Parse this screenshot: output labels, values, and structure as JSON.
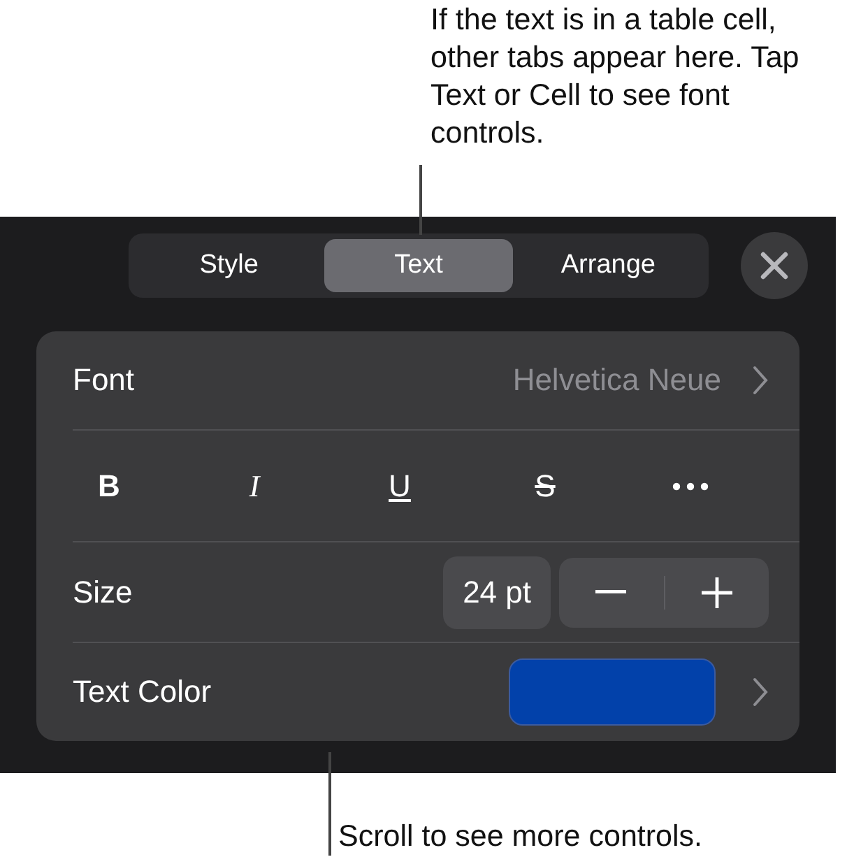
{
  "callout_top": "If the text is in a table cell, other tabs appear here. Tap Text or Cell to see font controls.",
  "tabs": [
    {
      "label": "Style",
      "selected": false
    },
    {
      "label": "Text",
      "selected": true
    },
    {
      "label": "Arrange",
      "selected": false
    }
  ],
  "font": {
    "label": "Font",
    "value": "Helvetica Neue"
  },
  "style_buttons": [
    {
      "kind": "bold",
      "label": "B"
    },
    {
      "kind": "italic",
      "label": "I"
    },
    {
      "kind": "underline",
      "label": "U"
    },
    {
      "kind": "strike",
      "label": "S"
    },
    {
      "kind": "more"
    }
  ],
  "size": {
    "label": "Size",
    "value": "24 pt"
  },
  "text_color": {
    "label": "Text Color",
    "color": "#0241aa"
  },
  "callout_bottom": "Scroll to see more controls."
}
